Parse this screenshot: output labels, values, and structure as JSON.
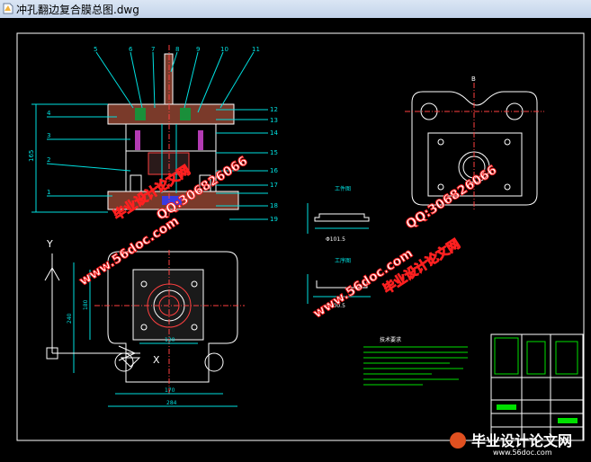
{
  "window": {
    "title": "冲孔翻边复合膜总图.dwg"
  },
  "drawing": {
    "part_numbers_top": [
      "5",
      "6",
      "7",
      "8",
      "9",
      "10",
      "11"
    ],
    "part_numbers_left": [
      "4",
      "3",
      "2",
      "1"
    ],
    "part_numbers_right": [
      "12",
      "13",
      "14",
      "15",
      "16",
      "17",
      "18",
      "19"
    ],
    "dimensions": {
      "height": "165",
      "plan_width": "170",
      "plan_width_outer": "284",
      "plan_inner": "120",
      "plan_height": "240",
      "plan_height_inner": "180"
    },
    "part_dims": {
      "top": "Φ101.5",
      "bottom": "Φ100.5"
    },
    "section_labels": {
      "top_view": "B",
      "part1": "工件图",
      "part2": "工序图"
    },
    "axis_y": "Y",
    "axis_x": "X",
    "notes_title": "技术要求"
  },
  "watermarks": {
    "site1": "毕业设计论文网",
    "url1": "www.56doc.com",
    "qq1": "QQ:306826066",
    "site2": "毕业设计论文网",
    "url2": "www.56doc.com",
    "qq2": "QQ:306826066",
    "footer_site": "毕业设计论文网",
    "footer_url": "www.56doc.com"
  }
}
